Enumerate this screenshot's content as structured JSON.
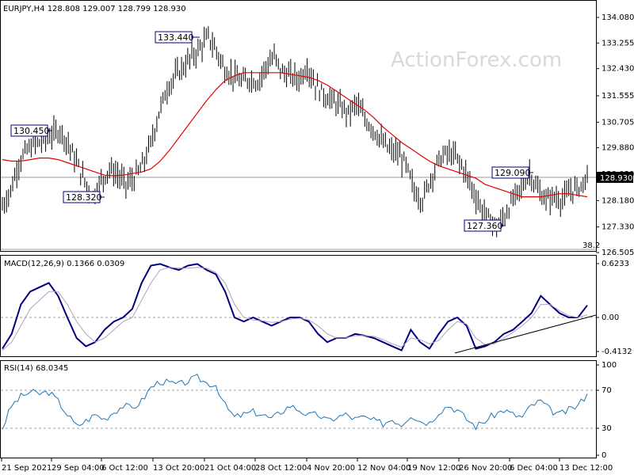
{
  "header": {
    "symbol_info": "EURJPY,H4  128.808 129.007 128.799 128.930"
  },
  "watermark": "ActionForex.com",
  "colors": {
    "price": "#000000",
    "ma": "#e00000",
    "macd": "#000080",
    "signal": "#b0a0c0",
    "rsi": "#1f77b4",
    "annotation_border": "#000080",
    "level_line": "#9a9a9a"
  },
  "chart_data": [
    {
      "type": "line",
      "panel": "price",
      "symbol": "EURJPY",
      "timeframe": "H4",
      "ohlc_last": {
        "open": 128.808,
        "high": 129.007,
        "low": 128.799,
        "close": 128.93
      },
      "y_ticks": [
        "134.080",
        "133.255",
        "132.430",
        "131.555",
        "130.705",
        "129.880",
        "129.030",
        "128.180",
        "127.330",
        "126.505"
      ],
      "y_tick_values": [
        134.08,
        133.255,
        132.43,
        131.555,
        130.705,
        129.88,
        129.03,
        128.18,
        127.33,
        126.505
      ],
      "ylim": [
        126.3,
        134.5
      ],
      "x_tick_labels": [
        "21 Sep 2021",
        "29 Sep 04:00",
        "6 Oct 12:00",
        "13 Oct 20:00",
        "21 Oct 04:00",
        "28 Oct 12:00",
        "4 Nov 20:00",
        "12 Nov 04:00",
        "19 Nov 12:00",
        "26 Nov 20:00",
        "6 Dec 04:00",
        "13 Dec 12:00"
      ],
      "price_series": {
        "name": "EURJPY",
        "values": [
          128.0,
          128.5,
          129.4,
          129.8,
          130.0,
          130.1,
          130.3,
          130.45,
          130.0,
          129.4,
          128.8,
          128.32,
          128.8,
          129.2,
          129.0,
          128.7,
          128.9,
          129.3,
          130.0,
          131.0,
          131.8,
          132.2,
          132.5,
          132.8,
          133.1,
          133.44,
          133.0,
          132.4,
          132.2,
          132.0,
          132.1,
          132.0,
          132.5,
          132.8,
          132.3,
          132.2,
          132.1,
          132.5,
          131.9,
          131.6,
          131.4,
          131.2,
          131.0,
          131.3,
          130.8,
          130.5,
          130.1,
          129.8,
          129.7,
          129.3,
          128.5,
          128.2,
          128.9,
          129.5,
          129.7,
          129.6,
          129.2,
          128.6,
          128.0,
          127.6,
          127.36,
          127.7,
          128.2,
          128.6,
          129.09,
          128.5,
          128.2,
          128.3,
          128.2,
          128.5,
          128.6,
          128.93
        ]
      },
      "ma_series": {
        "name": "MA",
        "values": [
          129.5,
          129.45,
          129.45,
          129.5,
          129.55,
          129.55,
          129.5,
          129.4,
          129.3,
          129.2,
          129.1,
          129.0,
          128.98,
          129.0,
          129.05,
          129.1,
          129.2,
          129.45,
          129.8,
          130.2,
          130.6,
          131.0,
          131.4,
          131.75,
          132.05,
          132.2,
          132.3,
          132.3,
          132.3,
          132.3,
          132.3,
          132.25,
          132.2,
          132.15,
          132.05,
          131.9,
          131.7,
          131.5,
          131.3,
          131.1,
          130.85,
          130.55,
          130.3,
          130.05,
          129.85,
          129.65,
          129.45,
          129.3,
          129.2,
          129.1,
          129.0,
          128.9,
          128.7,
          128.6,
          128.5,
          128.4,
          128.3,
          128.3,
          128.3,
          128.35,
          128.4,
          128.4,
          128.35,
          128.3
        ]
      },
      "annotations": [
        "133.440",
        "130.450",
        "128.320",
        "129.090",
        "127.360"
      ],
      "current_price_label": "128.930",
      "level_label": "38.2"
    },
    {
      "type": "line",
      "panel": "macd",
      "title": "MACD(12,26,9) 0.1366 0.0309",
      "y_ticks": [
        "0.6233",
        "0.00",
        "-0.4132"
      ],
      "ylim": [
        -0.45,
        0.65
      ],
      "series": [
        {
          "name": "MACD",
          "values": [
            -0.38,
            -0.2,
            0.15,
            0.3,
            0.35,
            0.4,
            0.25,
            0.0,
            -0.25,
            -0.35,
            -0.3,
            -0.15,
            -0.05,
            0.0,
            0.1,
            0.4,
            0.6,
            0.62,
            0.58,
            0.55,
            0.6,
            0.62,
            0.55,
            0.5,
            0.3,
            0.0,
            -0.05,
            0.0,
            -0.05,
            -0.1,
            -0.05,
            0.0,
            0.0,
            -0.05,
            -0.2,
            -0.3,
            -0.25,
            -0.25,
            -0.2,
            -0.22,
            -0.25,
            -0.3,
            -0.35,
            -0.4,
            -0.15,
            -0.3,
            -0.38,
            -0.2,
            -0.05,
            0.0,
            -0.1,
            -0.38,
            -0.35,
            -0.3,
            -0.2,
            -0.15,
            -0.05,
            0.05,
            0.25,
            0.15,
            0.05,
            0.0,
            0.0,
            0.14
          ]
        },
        {
          "name": "Signal",
          "values": [
            -0.4,
            -0.3,
            -0.1,
            0.1,
            0.2,
            0.3,
            0.3,
            0.15,
            -0.05,
            -0.2,
            -0.3,
            -0.25,
            -0.15,
            -0.05,
            0.0,
            0.2,
            0.4,
            0.55,
            0.58,
            0.57,
            0.57,
            0.58,
            0.57,
            0.52,
            0.4,
            0.15,
            0.0,
            -0.03,
            -0.04,
            -0.06,
            -0.05,
            -0.02,
            -0.01,
            -0.03,
            -0.1,
            -0.2,
            -0.25,
            -0.25,
            -0.22,
            -0.22,
            -0.23,
            -0.27,
            -0.32,
            -0.36,
            -0.25,
            -0.27,
            -0.32,
            -0.28,
            -0.15,
            -0.05,
            -0.08,
            -0.25,
            -0.33,
            -0.32,
            -0.25,
            -0.18,
            -0.1,
            0.0,
            0.15,
            0.15,
            0.08,
            0.02,
            0.0,
            0.03
          ]
        }
      ]
    },
    {
      "type": "line",
      "panel": "rsi",
      "title": "RSI(14) 68.0345",
      "y_ticks": [
        "100",
        "70",
        "30",
        "0"
      ],
      "ylim": [
        0,
        100
      ],
      "series": [
        {
          "name": "RSI",
          "values": [
            30,
            55,
            65,
            70,
            68,
            70,
            60,
            45,
            32,
            38,
            45,
            40,
            48,
            55,
            52,
            60,
            75,
            82,
            80,
            78,
            82,
            86,
            80,
            78,
            55,
            42,
            45,
            48,
            45,
            40,
            48,
            55,
            50,
            44,
            45,
            38,
            42,
            45,
            40,
            42,
            38,
            35,
            40,
            34,
            45,
            38,
            36,
            48,
            55,
            50,
            40,
            32,
            38,
            45,
            50,
            45,
            42,
            55,
            60,
            50,
            45,
            50,
            55,
            68
          ]
        }
      ]
    }
  ]
}
